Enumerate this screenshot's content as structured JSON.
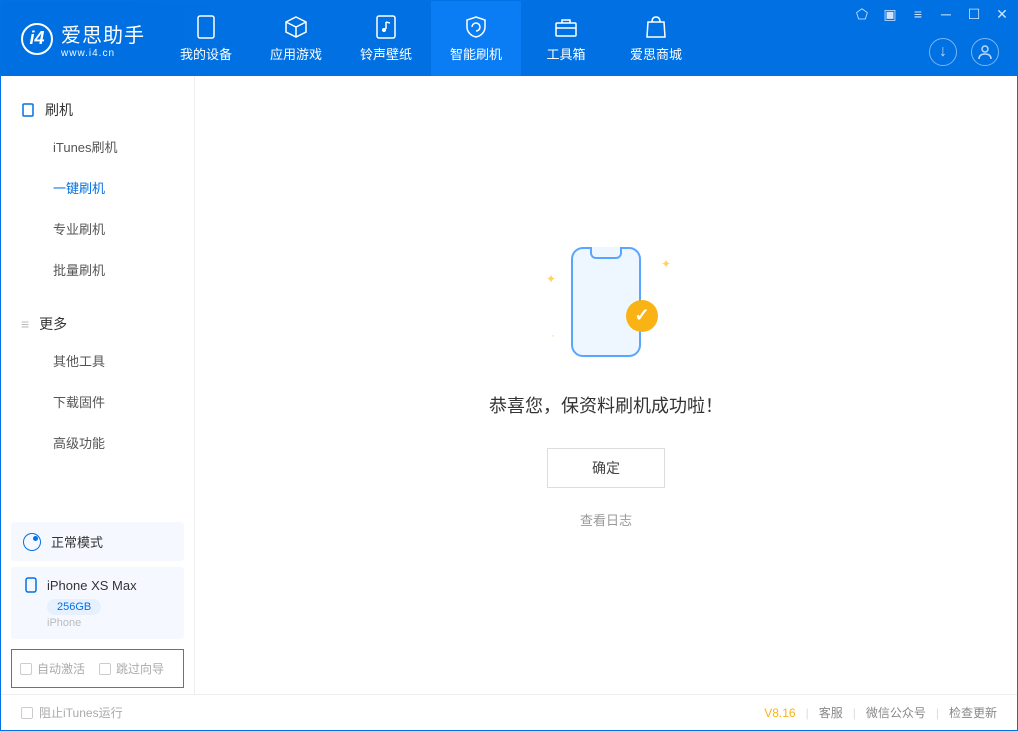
{
  "brand": {
    "name": "爱思助手",
    "url": "www.i4.cn"
  },
  "tabs": [
    {
      "label": "我的设备"
    },
    {
      "label": "应用游戏"
    },
    {
      "label": "铃声壁纸"
    },
    {
      "label": "智能刷机"
    },
    {
      "label": "工具箱"
    },
    {
      "label": "爱思商城"
    }
  ],
  "sidebar": {
    "section1": {
      "title": "刷机",
      "items": [
        "iTunes刷机",
        "一键刷机",
        "专业刷机",
        "批量刷机"
      ]
    },
    "section2": {
      "title": "更多",
      "items": [
        "其他工具",
        "下载固件",
        "高级功能"
      ]
    }
  },
  "device": {
    "mode": "正常模式",
    "name": "iPhone XS Max",
    "storage": "256GB",
    "type": "iPhone"
  },
  "options": {
    "auto_activate": "自动激活",
    "skip_guide": "跳过向导"
  },
  "main": {
    "message": "恭喜您，保资料刷机成功啦！",
    "ok": "确定",
    "view_log": "查看日志"
  },
  "footer": {
    "block_itunes": "阻止iTunes运行",
    "version": "V8.16",
    "support": "客服",
    "wechat": "微信公众号",
    "update": "检查更新"
  }
}
